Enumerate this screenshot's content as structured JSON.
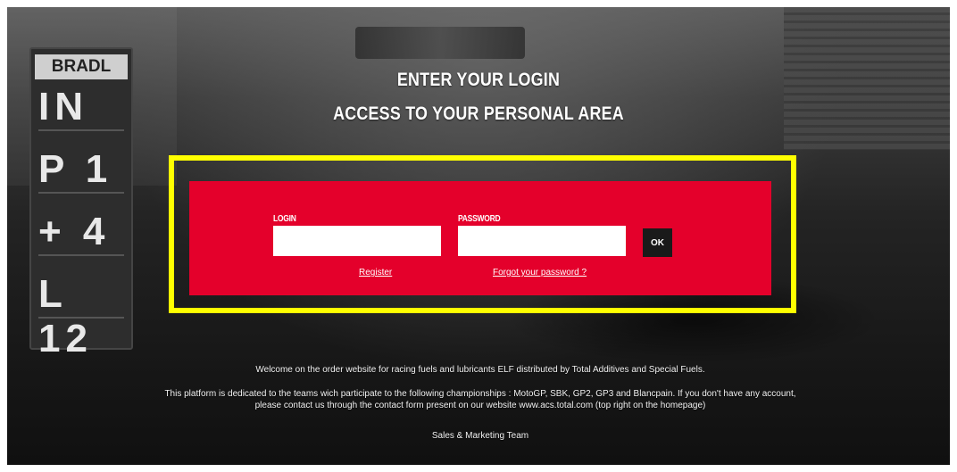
{
  "hero": {
    "title_line1": "ENTER YOUR LOGIN",
    "title_line2": "ACCESS TO YOUR PERSONAL AREA"
  },
  "pit_board": {
    "brand": "BRADL",
    "lines": [
      "IN",
      "P 1",
      "+ 4",
      "L 12"
    ]
  },
  "login_form": {
    "login_label": "LOGIN",
    "login_value": "",
    "password_label": "PASSWORD",
    "password_value": "",
    "ok_label": "OK",
    "register_link": "Register",
    "forgot_link": "Forgot your password ?"
  },
  "info": {
    "welcome": "Welcome on the order website for racing fuels and lubricants ELF distributed by Total Additives and Special Fuels.",
    "platform": "This platform is dedicated to the teams wich participate to the following championships : MotoGP, SBK, GP2, GP3 and Blancpain. If you don't have any account, please contact us through the contact form present on our website www.acs.total.com (top right on the homepage)",
    "signature": "Sales & Marketing Team"
  },
  "colors": {
    "panel_red": "#e4002b",
    "highlight_yellow": "#ffff00",
    "ok_button": "#1a1a1a"
  }
}
